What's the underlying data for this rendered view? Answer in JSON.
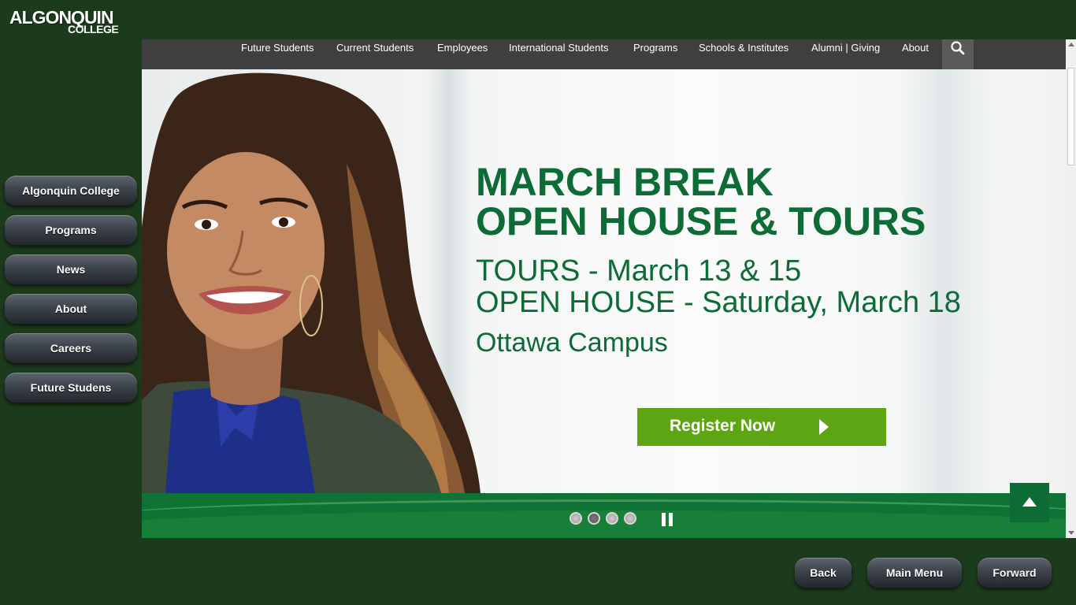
{
  "logo": {
    "line1": "ALGONQUIN",
    "line2": "COLLEGE"
  },
  "sidebar": {
    "items": [
      {
        "label": "Algonquin College"
      },
      {
        "label": "Programs"
      },
      {
        "label": "News"
      },
      {
        "label": "About"
      },
      {
        "label": "Careers"
      },
      {
        "label": "Future Studens"
      }
    ]
  },
  "topnav": {
    "items": [
      {
        "label": "Future Students"
      },
      {
        "label": "Current Students"
      },
      {
        "label": "Employees"
      },
      {
        "label": "International Students"
      },
      {
        "label": "Programs"
      },
      {
        "label": "Schools & Institutes"
      },
      {
        "label": "Alumni | Giving"
      },
      {
        "label": "About"
      }
    ],
    "search_icon": "search-icon"
  },
  "hero": {
    "headline_line1": "MARCH BREAK",
    "headline_line2": "OPEN HOUSE & TOURS",
    "tours": "TOURS - March 13 & 15",
    "open_house": "OPEN HOUSE - Saturday, March 18",
    "campus": "Ottawa Campus",
    "cta_label": "Register Now",
    "colors": {
      "headline": "#0d6b35",
      "cta": "#5ea514",
      "band": "#0f7336"
    }
  },
  "carousel": {
    "slide_count": 4,
    "active_slide": 2
  },
  "footer": {
    "back": "Back",
    "main_menu": "Main Menu",
    "forward": "Forward"
  },
  "theme": {
    "background": "#1c3a1c",
    "nav_bar": "#3f3f3f"
  }
}
